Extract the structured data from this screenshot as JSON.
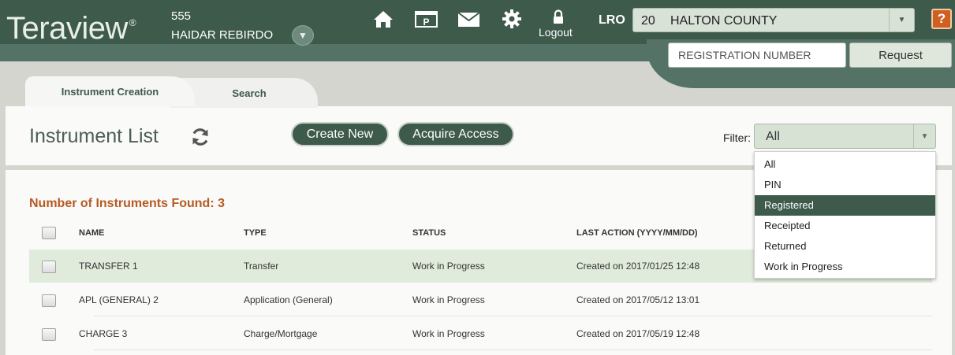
{
  "header": {
    "logo_text": "Teraview",
    "logo_mark": "®",
    "user_number": "555",
    "user_name": "HAIDAR REBIRDO",
    "icons": [
      "home-icon",
      "parking-icon",
      "mail-icon",
      "gear-icon",
      "lock-icon"
    ],
    "logout_label": "Logout",
    "lro_label": "LRO",
    "lro_code": "20",
    "lro_name": "HALTON COUNTY",
    "help_label": "?",
    "registration_placeholder": "REGISTRATION NUMBER",
    "request_label": "Request"
  },
  "tabs": [
    {
      "label": "Instrument Creation",
      "active": true
    },
    {
      "label": "Search",
      "active": false
    }
  ],
  "title_panel": {
    "title": "Instrument List",
    "create_new_label": "Create New",
    "acquire_access_label": "Acquire Access",
    "filter_label": "Filter:",
    "filter_value": "All"
  },
  "filter_options": [
    "All",
    "PIN",
    "Registered",
    "Receipted",
    "Returned",
    "Work in Progress"
  ],
  "filter_highlighted": "Registered",
  "list": {
    "count_label": "Number of Instruments Found: 3",
    "columns": [
      "NAME",
      "TYPE",
      "STATUS",
      "LAST ACTION (YYYY/MM/DD)"
    ],
    "rows": [
      {
        "name": "TRANSFER 1",
        "type": "Transfer",
        "status": "Work in Progress",
        "last_action": "Created on 2017/01/25 12:48",
        "selected": true
      },
      {
        "name": "APL (GENERAL) 2",
        "type": "Application (General)",
        "status": "Work in Progress",
        "last_action": "Created on 2017/05/12 13:01",
        "selected": false
      },
      {
        "name": "CHARGE 3",
        "type": "Charge/Mortgage",
        "status": "Work in Progress",
        "last_action": "Created on 2017/05/19 12:48",
        "selected": false
      }
    ]
  },
  "colors": {
    "header_dark": "#3d5a4a",
    "header_mid": "#557266",
    "accent_orange": "#b85a24",
    "help_orange": "#d0601f",
    "row_selected": "#e1ebdb"
  }
}
